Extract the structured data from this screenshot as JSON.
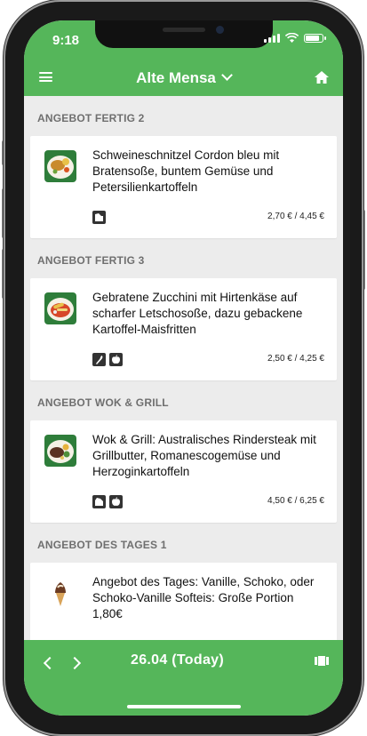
{
  "status_bar": {
    "time": "9:18"
  },
  "header": {
    "title": "Alte Mensa"
  },
  "sections": [
    {
      "title": "ANGEBOT FERTIG 2",
      "dish": "Schweineschnitzel Cordon bleu mit Bratensoße, buntem Gemüse und Petersilienkartoffeln",
      "icons": [
        "pork-icon"
      ],
      "price": "2,70 € / 4,45 €"
    },
    {
      "title": "ANGEBOT FERTIG 3",
      "dish": "Gebratene Zucchini mit Hirtenkäse auf scharfer Letschosoße, dazu gebackene Kartoffel-Maisfritten",
      "icons": [
        "vegetarian-icon",
        "apple-icon"
      ],
      "price": "2,50 € / 4,25 €"
    },
    {
      "title": "ANGEBOT WOK & GRILL",
      "dish": "Wok & Grill: Australisches Rindersteak mit Grillbutter, Romanescogemüse und Herzoginkartoffeln",
      "icons": [
        "beef-icon",
        "apple-icon"
      ],
      "price": "4,50 € / 6,25 €"
    },
    {
      "title": "ANGEBOT DES TAGES 1",
      "dish": "Angebot des Tages: Vanille, Schoko, oder Schoko-Vanille Softeis: Große Portion 1,80€",
      "icons": [],
      "price": ""
    }
  ],
  "bottom_bar": {
    "date": "26.04  (Today)"
  },
  "colors": {
    "brand_green": "#55b65a",
    "background": "#ececec"
  }
}
